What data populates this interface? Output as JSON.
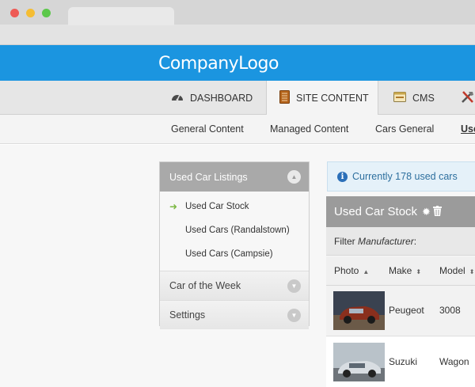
{
  "header": {
    "logo": "CompanyLogo",
    "brand_color": "#1b95e0"
  },
  "main_nav": {
    "items": [
      {
        "label": "DASHBOARD",
        "icon": "gauge-icon"
      },
      {
        "label": "SITE CONTENT",
        "icon": "document-icon",
        "active": true
      },
      {
        "label": "CMS",
        "icon": "window-icon"
      },
      {
        "label": "",
        "icon": "tools-icon"
      }
    ]
  },
  "sub_nav": {
    "items": [
      "General Content",
      "Managed Content",
      "Cars General",
      "Use"
    ],
    "active_index": 3
  },
  "sidebar": {
    "sections": [
      {
        "label": "Used Car Listings",
        "expanded": true,
        "links": [
          "Used Car Stock",
          "Used Cars (Randalstown)",
          "Used Cars (Campsie)"
        ],
        "current": "Used Car Stock"
      },
      {
        "label": "Car of the Week",
        "expanded": false
      },
      {
        "label": "Settings",
        "expanded": false
      }
    ]
  },
  "info": {
    "text": "Currently 178 used cars",
    "icon": "info-icon"
  },
  "stock": {
    "title": "Used Car Stock",
    "filter_prefix": "Filter ",
    "filter_field": "Manufacturer",
    "filter_suffix": ":",
    "columns": [
      "Photo",
      "Make",
      "Model"
    ],
    "rows": [
      {
        "make": "Peugeot",
        "model": "3008"
      },
      {
        "make": "Suzuki",
        "model": "Wagon"
      }
    ]
  }
}
